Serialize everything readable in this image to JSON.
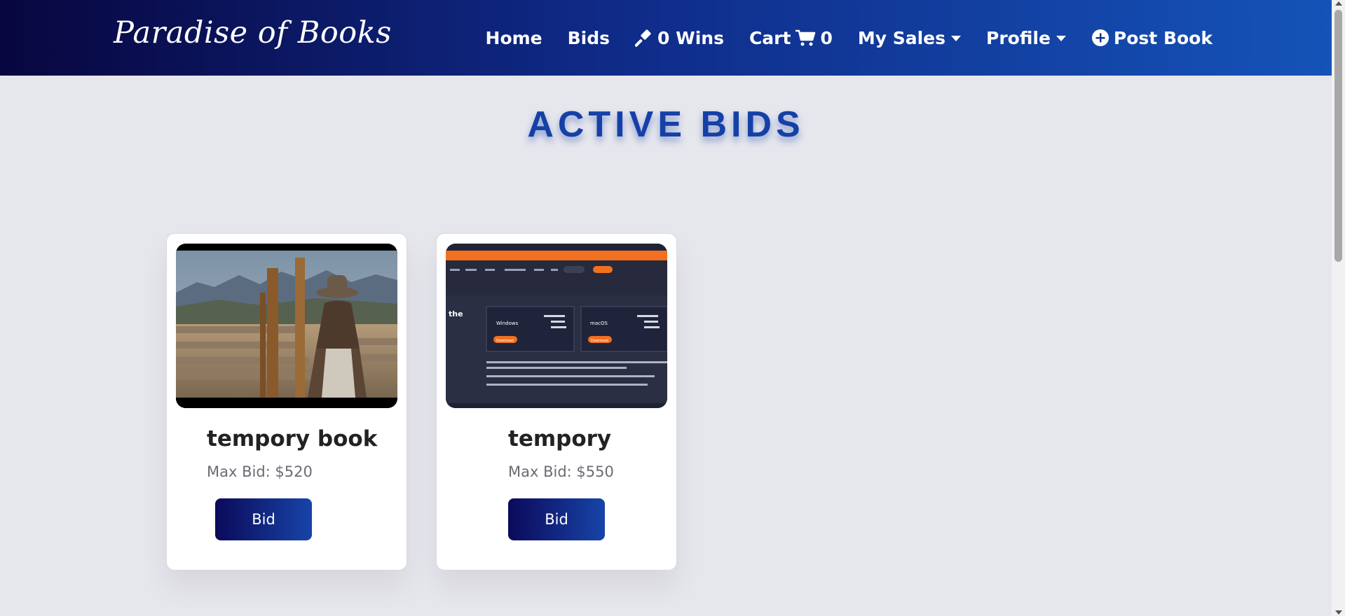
{
  "brand": "Paradise of Books",
  "nav": {
    "home": "Home",
    "bids": "Bids",
    "wins": "0 Wins",
    "cart": "Cart",
    "cart_count": "0",
    "my_sales": "My Sales",
    "profile": "Profile",
    "post_book": "Post Book"
  },
  "page_title": "ACTIVE BIDS",
  "cards": [
    {
      "title": "tempory book",
      "price": "Max Bid: $520",
      "button": "Bid",
      "image_name": "western-woman-at-fence-photo"
    },
    {
      "title": "tempory",
      "price": "Max Bid: $550",
      "button": "Bid",
      "image_name": "download-page-screenshot",
      "screenshot": {
        "side_text": "the",
        "windows_label": "Windows",
        "macos_label": "macOS",
        "download_label": "Download"
      }
    }
  ],
  "colors": {
    "accent": "#1540a6",
    "navbar_start": "#08063f",
    "navbar_end": "#1553b8",
    "screenshot_orange": "#f2701f",
    "screenshot_dark": "#262a3c"
  }
}
